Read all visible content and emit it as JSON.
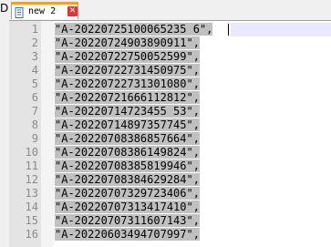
{
  "left_fragments": [
    "D",
    "",
    "",
    "",
    "",
    "",
    "",
    "",
    "",
    "",
    "",
    "",
    "",
    "",
    ""
  ],
  "tab": {
    "label": "new 2",
    "close_symbol": "✕",
    "accent_color": "#f0a030",
    "close_color": "#d43a3a"
  },
  "editor": {
    "lines": [
      {
        "num": "1",
        "text": "\"A-20220725100065235 6\","
      },
      {
        "num": "2",
        "text": "\"A-20220724903890911\","
      },
      {
        "num": "3",
        "text": "\"A-20220722750052599\","
      },
      {
        "num": "4",
        "text": "\"A-20220722731450975\","
      },
      {
        "num": "5",
        "text": "\"A-20220722731301080\","
      },
      {
        "num": "6",
        "text": "\"A-20220721666112812\","
      },
      {
        "num": "7",
        "text": "\"A-20220714723455 53\","
      },
      {
        "num": "8",
        "text": "\"A-20220714897357745\","
      },
      {
        "num": "9",
        "text": "\"A-20220708386857664\","
      },
      {
        "num": "10",
        "text": "\"A-20220708386149824\","
      },
      {
        "num": "11",
        "text": "\"A-20220708385819946\","
      },
      {
        "num": "12",
        "text": "\"A-20220708384629284\","
      },
      {
        "num": "13",
        "text": "\"A-20220707329723406\","
      },
      {
        "num": "14",
        "text": "\"A-20220707313417410\","
      },
      {
        "num": "15",
        "text": "\"A-20220707311607143\","
      },
      {
        "num": "16",
        "text": "\"A-20220603494707997\","
      }
    ],
    "selection_color": "#c0c0c0",
    "current_line_color": "#e8e8ff"
  }
}
